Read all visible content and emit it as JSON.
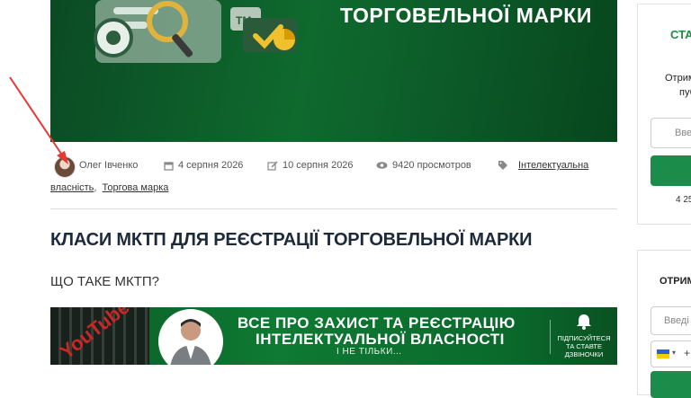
{
  "hero": {
    "title": "ТОРГОВЕЛЬНОЇ МАРКИ",
    "badge": "TM"
  },
  "meta": {
    "author": "Олег Івченко",
    "published": "4 серпня 2026",
    "updated": "10 серпня 2026",
    "views": "9420 просмотров",
    "tags": [
      "Інтелектуальна",
      "власність",
      "Торгова марка"
    ],
    "tag_separator": ","
  },
  "article": {
    "title": "КЛАСИ МКТП ДЛЯ РЕЄСТРАЦІЇ ТОРГОВЕЛЬНОЇ МАРКИ",
    "subtitle": "ЩО ТАКЕ МКТП?"
  },
  "banner": {
    "film_text": "YouTube",
    "line1": "ВСЕ ПРО ЗАХИСТ ТА РЕЄСТРАЦІЮ",
    "line2": "ІНТЕЛЕКТУАЛЬНОЇ ВЛАСНОСТІ",
    "line3": "І НЕ ТІЛЬКИ...",
    "subscribe": "ПІДПИСУЙТЕСЯ ТА СТАВТЕ ДЗВІНОЧКИ"
  },
  "sidebar_subscribe": {
    "title": "СТА",
    "text_line1": "Отрим",
    "text_line2": "пуб",
    "input_placeholder": "Вве",
    "count": "4 25"
  },
  "sidebar_form": {
    "title": "ОТРИМ",
    "input_placeholder": "Введі",
    "phone_prefix": "+"
  },
  "colors": {
    "accent": "#1c8c4b",
    "hero_bg": "#0f6a2e",
    "arrow": "#e53935"
  },
  "icons": [
    "calendar-icon",
    "edit-icon",
    "eye-icon",
    "tag-icon",
    "bell-icon"
  ]
}
